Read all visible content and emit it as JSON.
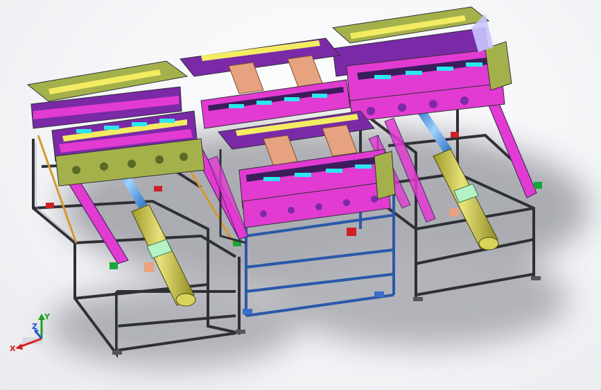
{
  "viewport": {
    "background": "#f4f5f7",
    "shadow_color": "#6d7078"
  },
  "model": {
    "frame_color": "#2f3036",
    "frame_highlight": "#9aa0a8",
    "plate_magenta": "#e23bd1",
    "plate_purple": "#7a2aa6",
    "plate_dark_purple": "#3b1d5c",
    "plate_olive": "#a4b14b",
    "plate_yellow": "#f3ec62",
    "copper": "#e7a27f",
    "cyan": "#2ce7ef",
    "blue_rod": "#5aa5e6",
    "blue_frame": "#2b58a9",
    "cylinder_yellow": "#d9d35a",
    "cylinder_mint": "#b5f2c5",
    "red_mount": "#cf2027",
    "green_block": "#18a53b",
    "orange_rail": "#d49a2d"
  },
  "triad": {
    "x_label": "X",
    "y_label": "Y",
    "z_label": "Z",
    "x_color": "#d51f1f",
    "y_color": "#1ea01e",
    "z_color": "#2253d6"
  }
}
